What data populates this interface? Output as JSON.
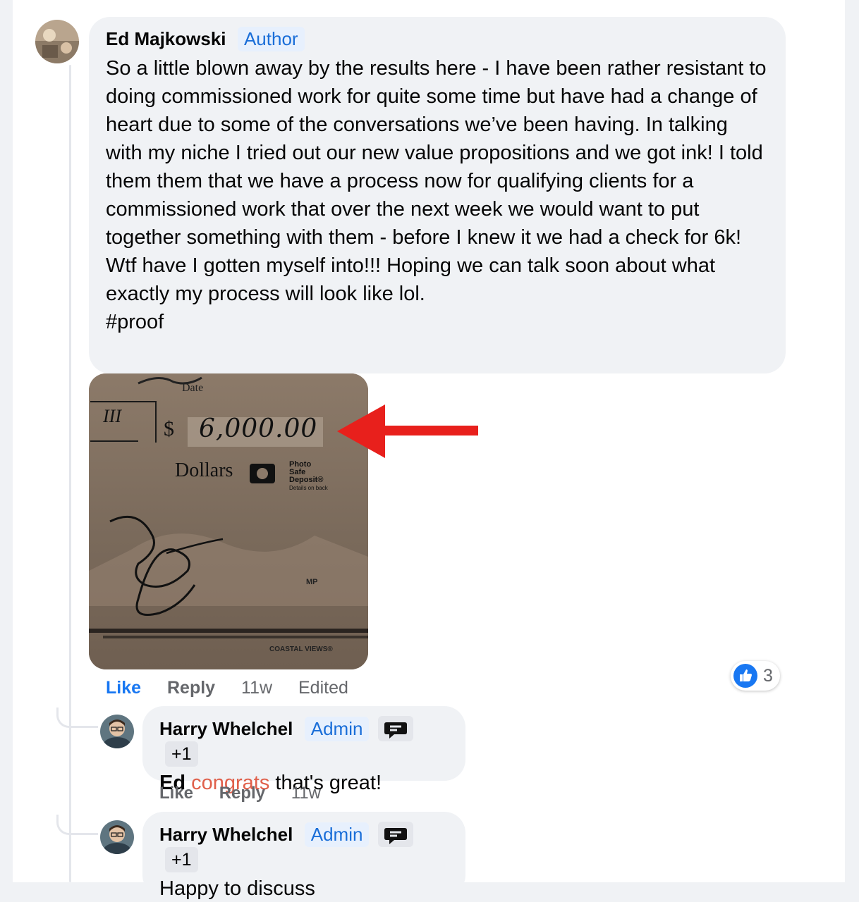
{
  "post": {
    "author": "Ed Majkowski",
    "badge": "Author",
    "text": "So a little blown away by the results here - I have been rather resistant to doing commissioned work for quite some time but have had a change of heart due to some of the conversations we’ve been having. In talking with my niche I tried out our new value propositions and we got ink! I told them them that we have a process now for qualifying clients for a commissioned work that over the next week we would want to put together something with them - before I knew it we had a check for 6k! Wtf have I gotten myself into!!! Hoping we can talk soon about what exactly my process will look like lol.\n#proof",
    "photo": {
      "date_label": "Date",
      "amount": "6,000.00",
      "dollar_sign": "$",
      "dollars_label": "Dollars",
      "photo_safe": "Photo Safe Deposit®",
      "details": "Details on back",
      "mp": "MP",
      "bank": "COASTAL VIEWS®"
    },
    "actions": {
      "like": "Like",
      "reply": "Reply",
      "time": "11w",
      "edited": "Edited"
    },
    "reaction_count": "3"
  },
  "replies": [
    {
      "author": "Harry Whelchel",
      "badge": "Admin",
      "extra_badge": "+1",
      "text_prefix": "Ed",
      "text_highlight": "congrats",
      "text_suffix": "that's great!",
      "actions": {
        "like": "Like",
        "reply": "Reply",
        "time": "11w"
      }
    },
    {
      "author": "Harry Whelchel",
      "badge": "Admin",
      "extra_badge": "+1",
      "text": "Happy to discuss"
    }
  ],
  "colors": {
    "link_blue": "#1877f2",
    "badge_blue": "#1a6ed8",
    "highlight": "#e0604b",
    "arrow": "#e8201c"
  }
}
